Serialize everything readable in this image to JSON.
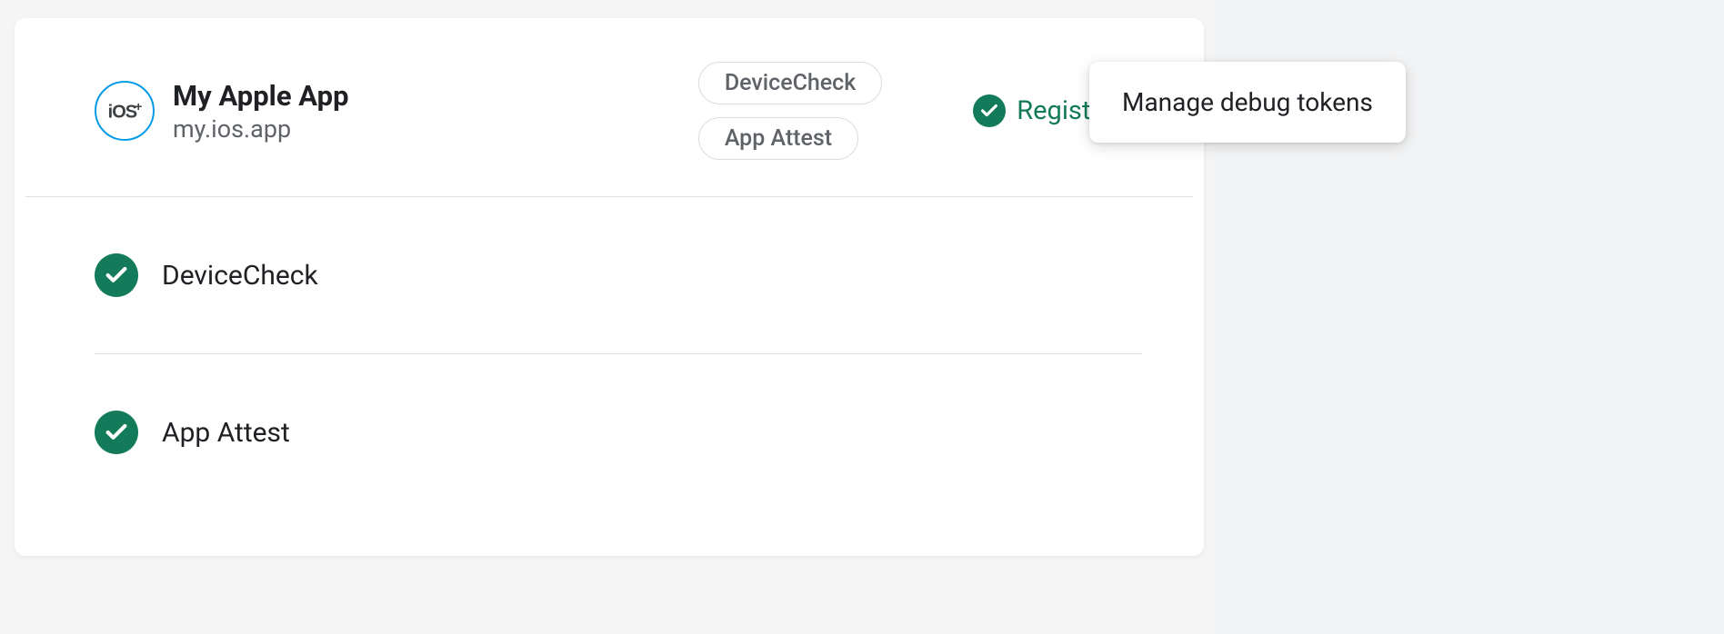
{
  "app": {
    "platform_icon_label": "iOS+",
    "name": "My Apple App",
    "bundle_id": "my.ios.app"
  },
  "header_chips": [
    "DeviceCheck",
    "App Attest"
  ],
  "status": {
    "label": "Registered"
  },
  "providers": [
    {
      "name": "DeviceCheck"
    },
    {
      "name": "App Attest"
    }
  ],
  "menu": {
    "manage_debug_tokens": "Manage debug tokens"
  },
  "colors": {
    "accent_green": "#137a5a",
    "text_primary": "#202124",
    "text_secondary": "#5f6368",
    "border": "#dadce0"
  }
}
